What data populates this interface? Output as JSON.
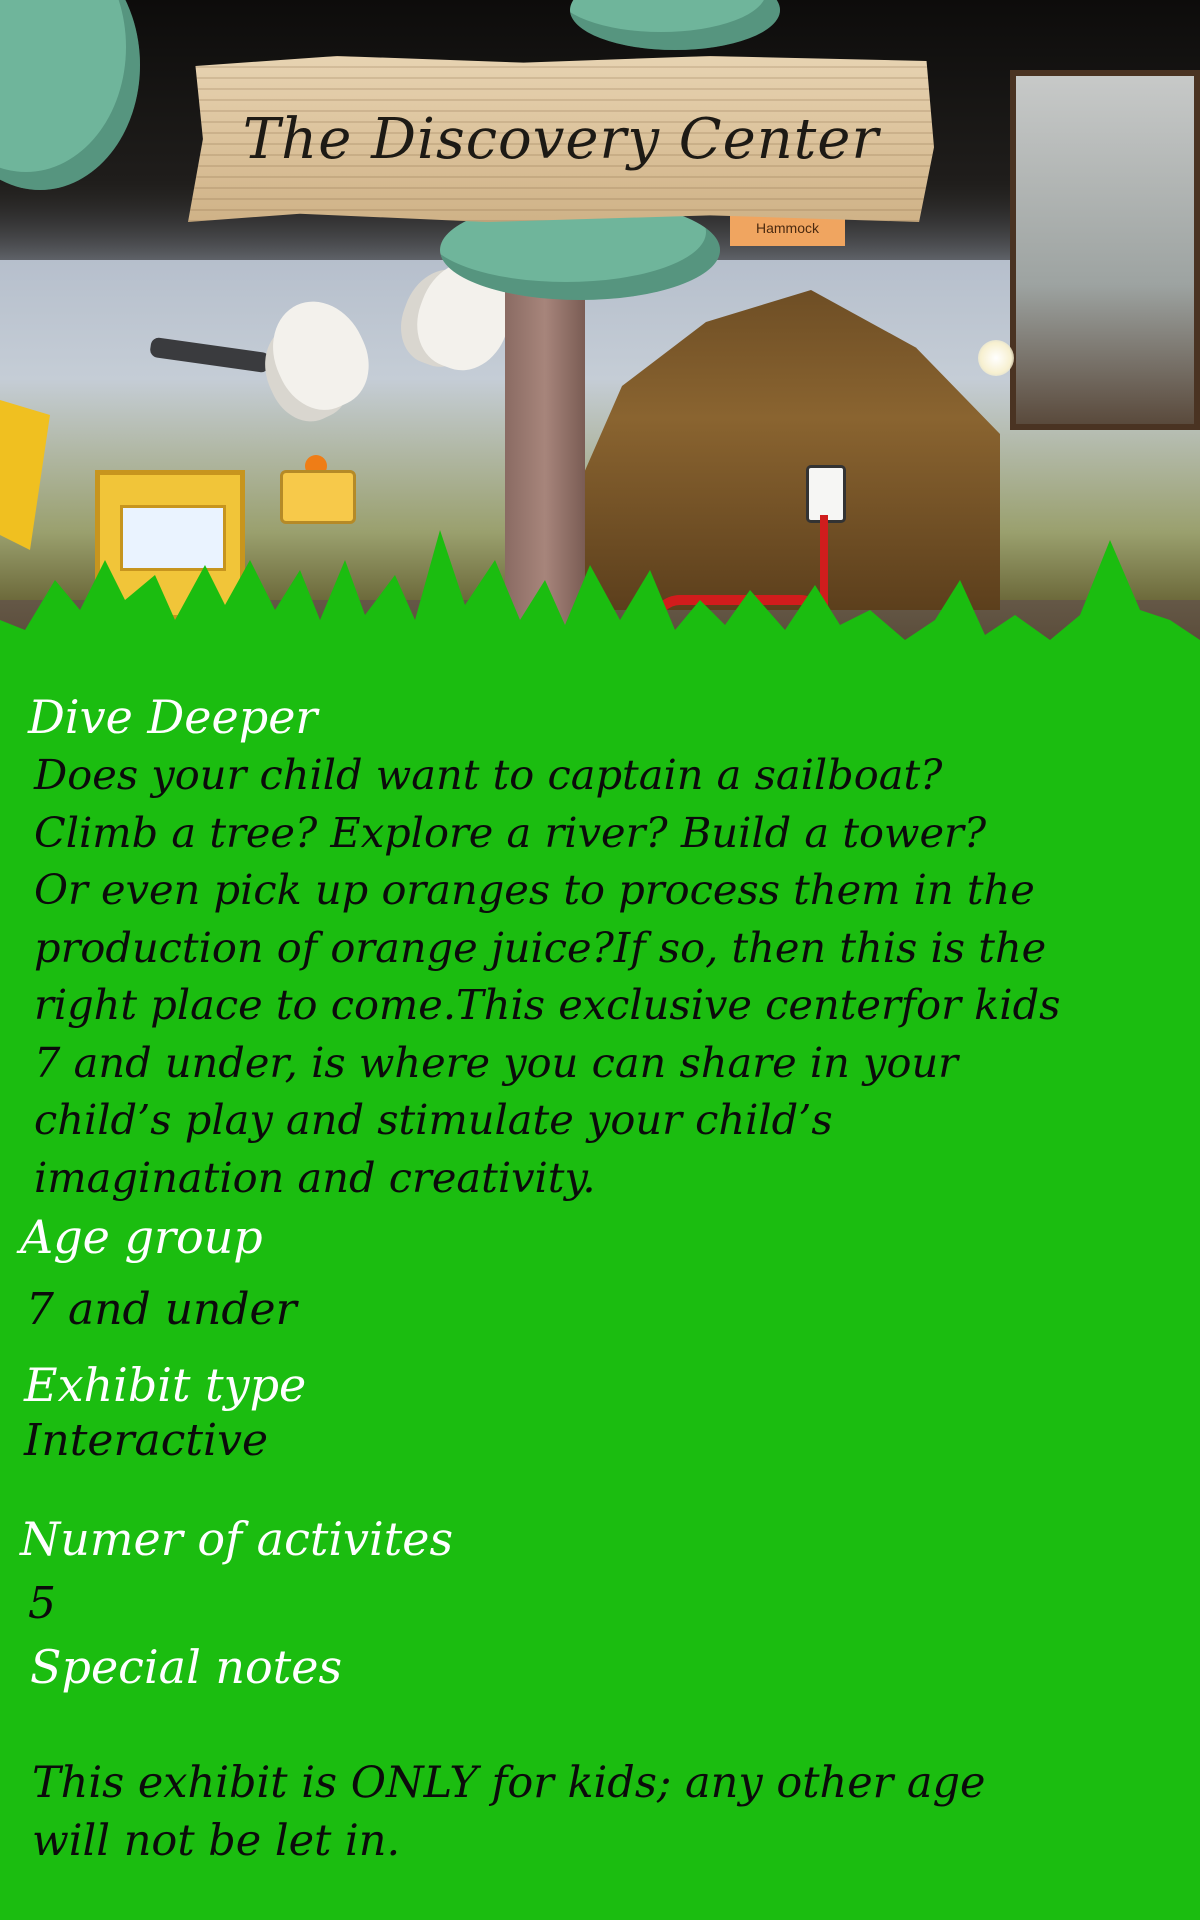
{
  "header": {
    "title": "The Discovery Center",
    "photo_signs": {
      "hammock": "Hammock"
    }
  },
  "intro": {
    "heading": "Dive Deeper",
    "body": "Does your child want to captain a sailboat?\nClimb a tree? Explore a river? Build a tower?\nOr even pick up oranges to process them in the\nproduction of orange juice?If so, then this is the\nright place to come.This exclusive centerfor kids\n7 and under, is where you can share in your\nchild’s play and stimulate your child’s\nimagination and creativity."
  },
  "details": {
    "age_group": {
      "label": "Age group",
      "value": "7 and under"
    },
    "exhibit_type": {
      "label": "Exhibit type",
      "value": "Interactive"
    },
    "activities": {
      "label": "Numer of activites",
      "value": "5"
    },
    "notes": {
      "label": "Special notes",
      "value": "This exhibit is ONLY for kids; any other age\nwill not be let in."
    }
  },
  "colors": {
    "grass_green": "#1bbd10",
    "label_white": "#ffffff",
    "text_black": "#0b0b0b",
    "wood_sign": "#dcc39c"
  }
}
